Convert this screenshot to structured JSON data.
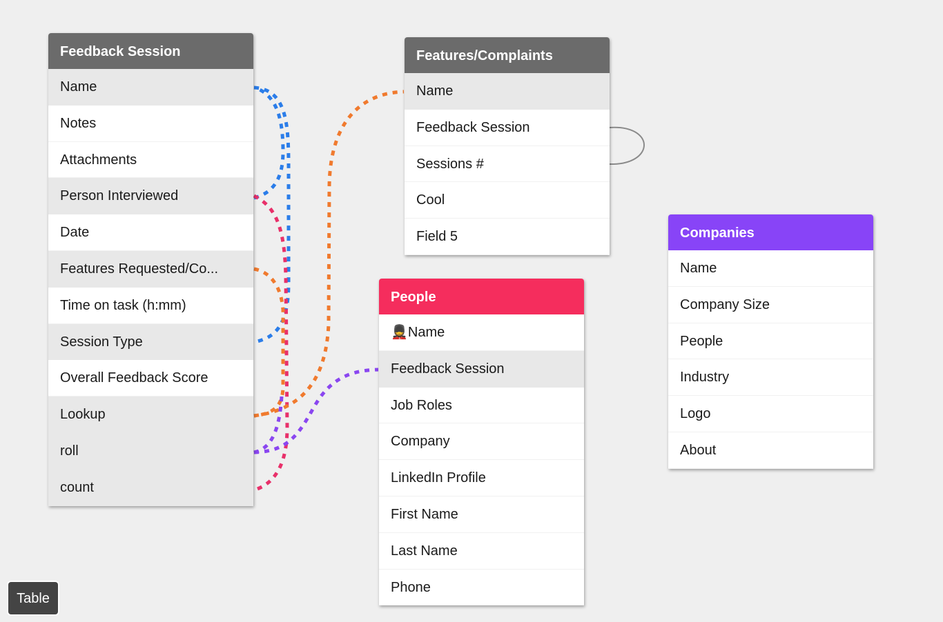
{
  "colors": {
    "background": "#efefef",
    "gray_header": "#6b6b6b",
    "people_header": "#f52d5d",
    "companies_header": "#8844f7",
    "link_blue": "#2b7de9",
    "link_pink": "#e8306a",
    "link_orange": "#f07a2e",
    "link_purple": "#8a46f0",
    "link_gray": "#8a8a8a"
  },
  "tables": [
    {
      "id": "feedback-session",
      "title": "Feedback Session",
      "header_color": "#6b6b6b",
      "fields": [
        {
          "label": "Name",
          "shaded": true
        },
        {
          "label": "Notes",
          "shaded": false
        },
        {
          "label": "Attachments",
          "shaded": false
        },
        {
          "label": "Person Interviewed",
          "shaded": true
        },
        {
          "label": "Date",
          "shaded": false
        },
        {
          "label": "Features Requested/Co...",
          "shaded": true
        },
        {
          "label": "Time on task (h:mm)",
          "shaded": false
        },
        {
          "label": "Session Type",
          "shaded": true
        },
        {
          "label": "Overall Feedback Score",
          "shaded": false
        },
        {
          "label": "Lookup",
          "shaded": true
        },
        {
          "label": "roll",
          "shaded": true
        },
        {
          "label": "count",
          "shaded": true
        }
      ]
    },
    {
      "id": "features-complaints",
      "title": "Features/Complaints",
      "header_color": "#6b6b6b",
      "fields": [
        {
          "label": "Name",
          "shaded": true
        },
        {
          "label": "Feedback Session",
          "shaded": false
        },
        {
          "label": "Sessions #",
          "shaded": false
        },
        {
          "label": "Cool",
          "shaded": false
        },
        {
          "label": "Field 5",
          "shaded": false
        }
      ]
    },
    {
      "id": "people",
      "title": "People",
      "header_color": "#f52d5d",
      "fields": [
        {
          "label": "💂Name",
          "shaded": false
        },
        {
          "label": "Feedback Session",
          "shaded": true
        },
        {
          "label": "Job Roles",
          "shaded": false
        },
        {
          "label": "Company",
          "shaded": false
        },
        {
          "label": "LinkedIn Profile",
          "shaded": false
        },
        {
          "label": "First Name",
          "shaded": false
        },
        {
          "label": "Last Name",
          "shaded": false
        },
        {
          "label": "Phone",
          "shaded": false
        }
      ]
    },
    {
      "id": "companies",
      "title": "Companies",
      "header_color": "#8844f7",
      "fields": [
        {
          "label": "Name",
          "shaded": false
        },
        {
          "label": "Company Size",
          "shaded": false
        },
        {
          "label": "People",
          "shaded": false
        },
        {
          "label": "Industry",
          "shaded": false
        },
        {
          "label": "Logo",
          "shaded": false
        },
        {
          "label": "About",
          "shaded": false
        }
      ]
    }
  ],
  "links": [
    {
      "from": "Feedback Session.Name",
      "to": "Feedback Session.Session Type",
      "color": "blue",
      "style": "dashed"
    },
    {
      "from": "Feedback Session.Person Interviewed",
      "to": "Feedback Session.Name",
      "color": "blue",
      "style": "dashed"
    },
    {
      "from": "Feedback Session.Person Interviewed",
      "to": "Feedback Session.count",
      "color": "pink",
      "style": "dashed"
    },
    {
      "from": "Feedback Session.Features Requested/Co...",
      "to": "Feedback Session.Lookup",
      "color": "orange",
      "style": "dashed"
    },
    {
      "from": "Feedback Session.Lookup",
      "to": "Features/Complaints.Name",
      "color": "orange",
      "style": "dashed"
    },
    {
      "from": "Feedback Session.roll",
      "to": "People.Feedback Session",
      "color": "purple",
      "style": "dashed"
    },
    {
      "from": "Feedback Session.roll",
      "to": "Feedback Session.Lookup",
      "color": "purple",
      "style": "dashed"
    },
    {
      "from": "Features/Complaints.Feedback Session",
      "to": "Features/Complaints.Sessions #",
      "color": "gray",
      "style": "solid"
    }
  ],
  "toolbar": {
    "table_button_label": "Table"
  }
}
